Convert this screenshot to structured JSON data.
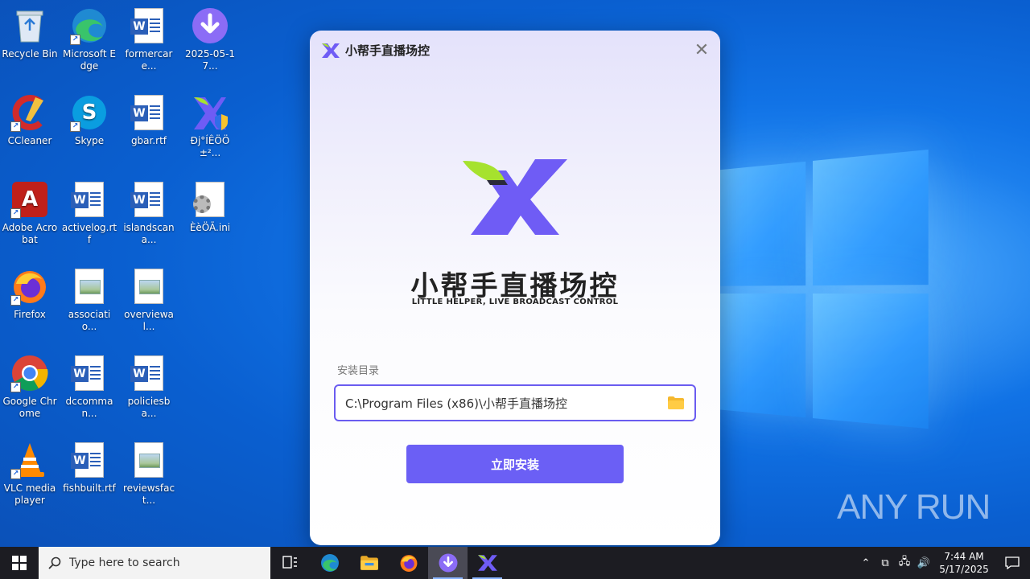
{
  "desktop": {
    "icons": [
      {
        "label": "Recycle Bin"
      },
      {
        "label": "Microsoft Edge"
      },
      {
        "label": "formercare..."
      },
      {
        "label": "2025-05-17..."
      },
      {
        "label": "CCleaner"
      },
      {
        "label": "Skype"
      },
      {
        "label": "gbar.rtf"
      },
      {
        "label": "Ðj°ÍÊÖÖ±²..."
      },
      {
        "label": "Adobe Acrobat"
      },
      {
        "label": "activelog.rtf"
      },
      {
        "label": "islandscana..."
      },
      {
        "label": "ÈèÖÃ.ini"
      },
      {
        "label": "Firefox"
      },
      {
        "label": "associatio..."
      },
      {
        "label": "overviewal..."
      },
      {
        "label": "Google Chrome"
      },
      {
        "label": "dccomman..."
      },
      {
        "label": "policiesba..."
      },
      {
        "label": "VLC media player"
      },
      {
        "label": "fishbuilt.rtf"
      },
      {
        "label": "reviewsfact..."
      }
    ]
  },
  "dialog": {
    "title": "小帮手直播场控",
    "brand_cn": "小帮手直播场控",
    "brand_en": "LITTLE HELPER, LIVE BROADCAST CONTROL",
    "dir_label": "安装目录",
    "dir_value": "C:\\Program Files (x86)\\小帮手直播场控",
    "install_label": "立即安装",
    "accent": "#6b5ff5",
    "logo_green": "#a6e22e"
  },
  "watermark": {
    "text": "ANY RUN"
  },
  "taskbar": {
    "search_placeholder": "Type here to search",
    "time": "7:44 AM",
    "date": "5/17/2025"
  }
}
